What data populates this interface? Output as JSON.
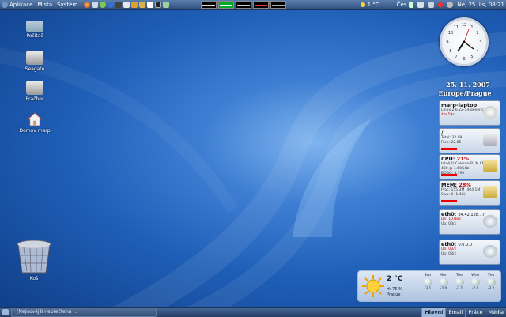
{
  "top_panel": {
    "menu": [
      "Aplikace",
      "Místa",
      "Systém"
    ],
    "weather_temp": "1 °C",
    "lang": "Čes",
    "datetime": "Ne, 25. lis, 08:21"
  },
  "desktop_icons": [
    {
      "label": "Počítač"
    },
    {
      "label": "Seagate"
    },
    {
      "label": "Pračher"
    },
    {
      "label": "Domov marp"
    }
  ],
  "trash": {
    "label": "Koš"
  },
  "clock": {
    "date": "25. 11. 2007",
    "zone": "Europe/Prague"
  },
  "cards": [
    {
      "title": "marp-laptop",
      "lines": [
        "Linux  2.6.22-14-generic",
        "4m 59s"
      ]
    },
    {
      "title": "/",
      "lines": [
        "Total: 32.09",
        "Free:  22.65"
      ]
    },
    {
      "title": "CPU:",
      "title_extra": "21%",
      "lines": [
        "Intel(R) Celeron(R) M CPU",
        "430   @ 1.60GHz",
        "BOGO: 3,190"
      ]
    },
    {
      "title": "MEM:",
      "title_extra": "28%",
      "lines": [
        "Proc: 155.3M  (404.1M)",
        "Swp: 0 (1.4G)"
      ]
    },
    {
      "title": "eth0:",
      "title_extra": "84.42.128.77",
      "lines": [
        "Dn: 107B/s",
        "Up: 0B/s"
      ]
    },
    {
      "title": "eth0:",
      "title_extra": "0.0.0.0",
      "lines": [
        "Dn: 0B/s",
        "Up: 0B/s"
      ]
    }
  ],
  "weather": {
    "temp": "2 °C",
    "humidity": "H: 75 %",
    "city": "Prague",
    "days": [
      {
        "name": "Sun",
        "range": "-3  1"
      },
      {
        "name": "Mon",
        "range": "-2  0"
      },
      {
        "name": "Tue",
        "range": "-3  1"
      },
      {
        "name": "Wed",
        "range": "-2  0"
      },
      {
        "name": "Thu",
        "range": "-3  2"
      }
    ]
  },
  "bottom_panel": {
    "task": "[Nejnovější nepřečtená ...",
    "workspaces": [
      "Hlavní",
      "Email",
      "Práce",
      "Média"
    ]
  },
  "colors": {
    "accent": "#2e4f7e",
    "desktop": "#1f5fb8",
    "meter_red": "#e00000"
  }
}
